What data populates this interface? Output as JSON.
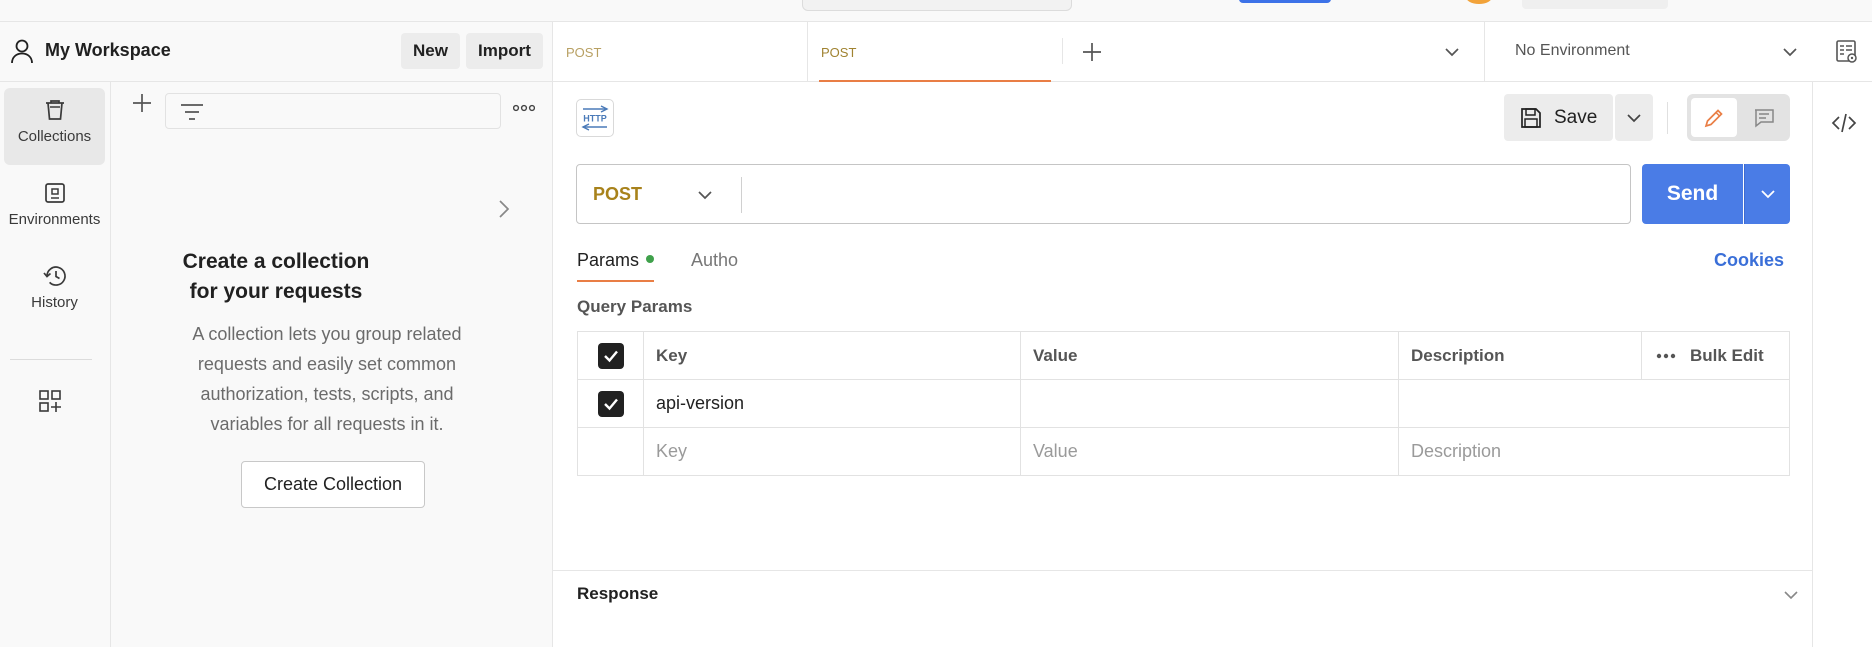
{
  "workspace": {
    "title": "My Workspace",
    "new_label": "New",
    "import_label": "Import"
  },
  "rail": {
    "collections": "Collections",
    "environments": "Environments",
    "history": "History"
  },
  "collections_pane": {
    "empty_title": "Create a collection for your requests",
    "empty_desc": "A collection lets you group related requests and easily set common authorization, tests, scripts, and variables for all requests in it.",
    "create_button": "Create Collection"
  },
  "tabs": [
    {
      "label": "POST"
    },
    {
      "label": "POST",
      "active": true
    }
  ],
  "environment": {
    "label": "No Environment"
  },
  "request": {
    "badge": "HTTP",
    "save_label": "Save",
    "method": "POST",
    "url": "",
    "send_label": "Send",
    "subtabs": {
      "params": "Params",
      "auth": "Autho"
    },
    "cookies": "Cookies",
    "query_params_label": "Query Params",
    "table": {
      "headers": {
        "key": "Key",
        "value": "Value",
        "description": "Description",
        "bulk_edit": "Bulk Edit"
      },
      "rows": [
        {
          "checked": true,
          "key": "api-version",
          "value": "",
          "description": ""
        }
      ],
      "placeholder": {
        "key": "Key",
        "value": "Value",
        "description": "Description"
      }
    }
  },
  "response": {
    "label": "Response"
  },
  "colors": {
    "accent": "#e97e45",
    "send": "#4a7ce6",
    "method": "#a8821b",
    "link": "#3a6fd8",
    "dot": "#3fa14b"
  }
}
